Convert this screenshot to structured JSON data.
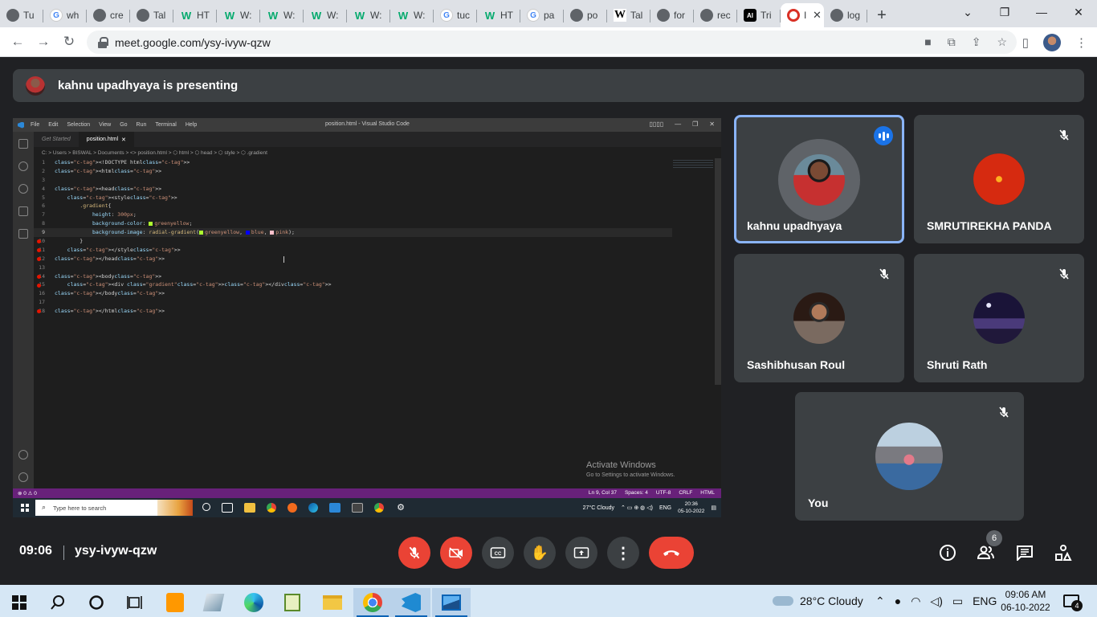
{
  "browser": {
    "tabs": [
      {
        "icon": "globe-icon",
        "title": "Tu"
      },
      {
        "icon": "google-icon",
        "title": "wh"
      },
      {
        "icon": "globe-icon",
        "title": "cre"
      },
      {
        "icon": "globe-icon",
        "title": "Tal"
      },
      {
        "icon": "w3schools-icon",
        "title": "HT"
      },
      {
        "icon": "w3schools-icon",
        "title": "W:"
      },
      {
        "icon": "w3schools-icon",
        "title": "W:"
      },
      {
        "icon": "w3schools-icon",
        "title": "W:"
      },
      {
        "icon": "w3schools-icon",
        "title": "W:"
      },
      {
        "icon": "w3schools-icon",
        "title": "W:"
      },
      {
        "icon": "google-icon",
        "title": "tuc"
      },
      {
        "icon": "w3schools-icon",
        "title": "HT"
      },
      {
        "icon": "google-icon",
        "title": "pa"
      },
      {
        "icon": "globe-icon",
        "title": "po"
      },
      {
        "icon": "wikipedia-icon",
        "title": "Tal"
      },
      {
        "icon": "globe-icon",
        "title": "for"
      },
      {
        "icon": "globe-icon",
        "title": "rec"
      },
      {
        "icon": "ai-icon",
        "title": "Tri"
      },
      {
        "icon": "recording-icon",
        "title": "I"
      },
      {
        "icon": "globe-icon",
        "title": "log"
      }
    ],
    "active_tab_index": 18,
    "url": "meet.google.com/ysy-ivyw-qzw"
  },
  "meet": {
    "presenting_banner": "kahnu upadhyaya is presenting",
    "time": "09:06",
    "meeting_code": "ysy-ivyw-qzw",
    "people_count": "6",
    "participants": [
      {
        "name": "kahnu upadhyaya",
        "speaking": true,
        "muted": false
      },
      {
        "name": "SMRUTIREKHA PANDA",
        "speaking": false,
        "muted": true
      },
      {
        "name": "Sashibhusan Roul",
        "speaking": false,
        "muted": true
      },
      {
        "name": "Shruti Rath",
        "speaking": false,
        "muted": true
      },
      {
        "name": "You",
        "speaking": false,
        "muted": true
      }
    ]
  },
  "shared_screen": {
    "menu": [
      "File",
      "Edit",
      "Selection",
      "View",
      "Go",
      "Run",
      "Terminal",
      "Help"
    ],
    "window_title": "position.html - Visual Studio Code",
    "tabs": [
      "Get Started",
      "position.html"
    ],
    "breadcrumb": "C: > Users > BISWAL > Documents > <> position.html > ⬡ html > ⬡ head > ⬡ style > ⬡ .gradient",
    "code_lines": [
      {
        "n": "1",
        "t": "<!DOCTYPE html>"
      },
      {
        "n": "2",
        "t": "<html>"
      },
      {
        "n": "3",
        "t": ""
      },
      {
        "n": "4",
        "t": "<head>"
      },
      {
        "n": "5",
        "t": "    <style>"
      },
      {
        "n": "6",
        "t": "        .gradient{"
      },
      {
        "n": "7",
        "t": "            height: 300px;"
      },
      {
        "n": "8",
        "t": "            background-color: greenyellow;"
      },
      {
        "n": "9",
        "t": "            background-image: radial-gradient(greenyellow, blue, pink);"
      },
      {
        "n": "10",
        "t": "        }"
      },
      {
        "n": "11",
        "t": "    </style>"
      },
      {
        "n": "12",
        "t": "</head>"
      },
      {
        "n": "13",
        "t": ""
      },
      {
        "n": "14",
        "t": "<body>"
      },
      {
        "n": "15",
        "t": "    <div class=\"gradient\"></div>"
      },
      {
        "n": "16",
        "t": "</body>"
      },
      {
        "n": "17",
        "t": ""
      },
      {
        "n": "18",
        "t": "</html>"
      }
    ],
    "activate_title": "Activate Windows",
    "activate_sub": "Go to Settings to activate Windows.",
    "status_left": "⊗ 0 ⚠ 0",
    "status_right": [
      "Ln 9, Col 37",
      "Spaces: 4",
      "UTF-8",
      "CRLF",
      "HTML"
    ],
    "taskbar_search": "Type here to search",
    "weather": "27°C Cloudy",
    "lang": "ENG",
    "time": "20:36",
    "date": "05-10-2022"
  },
  "taskbar": {
    "weather": "28°C  Cloudy",
    "lang": "ENG",
    "time": "09:06 AM",
    "date": "06-10-2022",
    "notifications": "4"
  },
  "colors": {
    "meet_bg": "#202124",
    "tile_bg": "#3c4043",
    "speaking_border": "#8ab4f8",
    "danger": "#ea4335",
    "vscode_status": "#68217a"
  }
}
